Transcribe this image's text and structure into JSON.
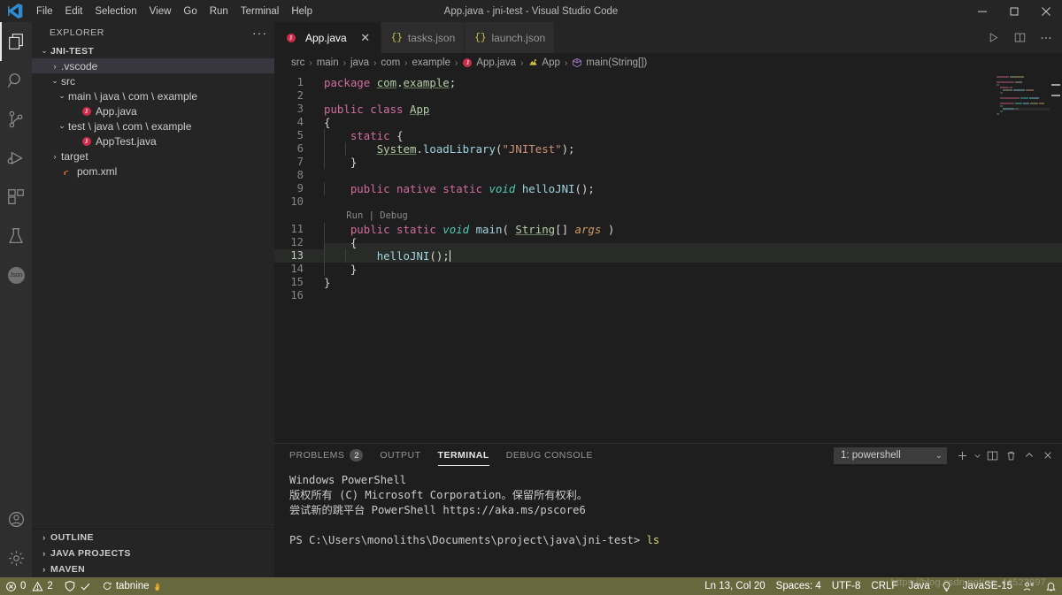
{
  "window": {
    "title": "App.java - jni-test - Visual Studio Code",
    "minimize_label": "─",
    "maximize_label": "❐",
    "close_label": "✕"
  },
  "menubar": {
    "items": [
      {
        "label": "File"
      },
      {
        "label": "Edit"
      },
      {
        "label": "Selection"
      },
      {
        "label": "View"
      },
      {
        "label": "Go"
      },
      {
        "label": "Run"
      },
      {
        "label": "Terminal"
      },
      {
        "label": "Help"
      }
    ]
  },
  "activitybar": {
    "items": [
      {
        "name": "explorer",
        "icon": "files-icon",
        "active": true
      },
      {
        "name": "search",
        "icon": "search-icon",
        "active": false
      },
      {
        "name": "source-control",
        "icon": "source-control-icon",
        "active": false
      },
      {
        "name": "run-and-debug",
        "icon": "run-debug-icon",
        "active": false
      },
      {
        "name": "extensions",
        "icon": "extensions-icon",
        "active": false
      },
      {
        "name": "testing",
        "icon": "beaker-icon",
        "active": false
      },
      {
        "name": "json-viewer",
        "icon": "json-badge-icon",
        "label": "Json",
        "active": false
      }
    ],
    "bottom": [
      {
        "name": "accounts",
        "icon": "account-icon"
      },
      {
        "name": "manage-settings",
        "icon": "gear-icon"
      }
    ]
  },
  "sidebar": {
    "header_title": "EXPLORER",
    "more_actions": "···",
    "tree": [
      {
        "label": "JNI-TEST",
        "kind": "root",
        "depth": 0,
        "twisty": "⌄",
        "selected": false
      },
      {
        "label": ".vscode",
        "kind": "folder",
        "depth": 1,
        "twisty": "›",
        "selected": true
      },
      {
        "label": "src",
        "kind": "folder",
        "depth": 1,
        "twisty": "⌄",
        "selected": false
      },
      {
        "label": "main \\ java \\ com \\ example",
        "kind": "folder",
        "depth": 2,
        "twisty": "⌄",
        "selected": false
      },
      {
        "label": "App.java",
        "kind": "java",
        "depth": 3,
        "twisty": "",
        "selected": false
      },
      {
        "label": "test \\ java \\ com \\ example",
        "kind": "folder",
        "depth": 2,
        "twisty": "⌄",
        "selected": false
      },
      {
        "label": "AppTest.java",
        "kind": "java",
        "depth": 3,
        "twisty": "",
        "selected": false
      },
      {
        "label": "target",
        "kind": "folder",
        "depth": 1,
        "twisty": "›",
        "selected": false
      },
      {
        "label": "pom.xml",
        "kind": "xml",
        "depth": 1,
        "twisty": "",
        "selected": false
      }
    ],
    "sections": [
      {
        "label": "OUTLINE",
        "twisty": "›"
      },
      {
        "label": "JAVA PROJECTS",
        "twisty": "›"
      },
      {
        "label": "MAVEN",
        "twisty": "›"
      }
    ]
  },
  "editor": {
    "tabs": [
      {
        "label": "App.java",
        "icon": "java-file-icon",
        "active": true,
        "closable": true,
        "close_label": "✕"
      },
      {
        "label": "tasks.json",
        "icon": "json-file-icon",
        "active": false,
        "closable": false
      },
      {
        "label": "launch.json",
        "icon": "json-file-icon",
        "active": false,
        "closable": false
      }
    ],
    "actions": [
      {
        "name": "run-code-button",
        "icon": "play-icon"
      },
      {
        "name": "split-editor-button",
        "icon": "split-editor-icon"
      },
      {
        "name": "more-actions-button",
        "icon": "ellipsis-icon"
      }
    ],
    "breadcrumbs": [
      {
        "label": "src",
        "icon": ""
      },
      {
        "label": "main",
        "icon": ""
      },
      {
        "label": "java",
        "icon": ""
      },
      {
        "label": "com",
        "icon": ""
      },
      {
        "label": "example",
        "icon": ""
      },
      {
        "label": "App.java",
        "icon": "java-file-icon"
      },
      {
        "label": "App",
        "icon": "class-icon"
      },
      {
        "label": "main(String[])",
        "icon": "method-icon"
      }
    ],
    "breadcrumb_separator": "›",
    "codelens": {
      "run": "Run",
      "divider": "|",
      "debug": "Debug"
    },
    "lines": [
      {
        "n": "1",
        "tokens": [
          {
            "t": "package ",
            "c": "k"
          },
          {
            "t": "com",
            "c": "typ"
          },
          {
            "t": ".",
            "c": "pun"
          },
          {
            "t": "example",
            "c": "typ"
          },
          {
            "t": ";",
            "c": "pun"
          }
        ]
      },
      {
        "n": "2",
        "tokens": []
      },
      {
        "n": "3",
        "tokens": [
          {
            "t": "public class ",
            "c": "k"
          },
          {
            "t": "App",
            "c": "cls"
          }
        ]
      },
      {
        "n": "4",
        "tokens": [
          {
            "t": "{",
            "c": "plain"
          }
        ]
      },
      {
        "n": "5",
        "tokens": [
          {
            "t": "    ",
            "c": "plain"
          },
          {
            "t": "static",
            "c": "k"
          },
          {
            "t": " {",
            "c": "plain"
          }
        ]
      },
      {
        "n": "6",
        "tokens": [
          {
            "t": "        ",
            "c": "plain"
          },
          {
            "t": "System",
            "c": "typ"
          },
          {
            "t": ".",
            "c": "pun"
          },
          {
            "t": "loadLibrary",
            "c": "fn"
          },
          {
            "t": "(",
            "c": "pun"
          },
          {
            "t": "\"JNITest\"",
            "c": "str"
          },
          {
            "t": ");",
            "c": "pun"
          }
        ]
      },
      {
        "n": "7",
        "tokens": [
          {
            "t": "    }",
            "c": "plain"
          }
        ]
      },
      {
        "n": "8",
        "tokens": []
      },
      {
        "n": "9",
        "tokens": [
          {
            "t": "    ",
            "c": "plain"
          },
          {
            "t": "public native static ",
            "c": "k"
          },
          {
            "t": "void",
            "c": "vd"
          },
          {
            "t": " ",
            "c": "plain"
          },
          {
            "t": "helloJNI",
            "c": "fn"
          },
          {
            "t": "();",
            "c": "pun"
          }
        ]
      },
      {
        "n": "10",
        "tokens": []
      },
      {
        "n": "11",
        "tokens": [
          {
            "t": "    ",
            "c": "plain"
          },
          {
            "t": "public static ",
            "c": "k"
          },
          {
            "t": "void",
            "c": "vd"
          },
          {
            "t": " ",
            "c": "plain"
          },
          {
            "t": "main",
            "c": "fn"
          },
          {
            "t": "( ",
            "c": "pun"
          },
          {
            "t": "String",
            "c": "cls"
          },
          {
            "t": "[] ",
            "c": "pun"
          },
          {
            "t": "args",
            "c": "prm"
          },
          {
            "t": " )",
            "c": "pun"
          }
        ]
      },
      {
        "n": "12",
        "tokens": [
          {
            "t": "    {",
            "c": "plain"
          }
        ]
      },
      {
        "n": "13",
        "tokens": [
          {
            "t": "        ",
            "c": "plain"
          },
          {
            "t": "helloJNI",
            "c": "fn"
          },
          {
            "t": "();",
            "c": "pun"
          }
        ],
        "highlight": true,
        "caret": true
      },
      {
        "n": "14",
        "tokens": [
          {
            "t": "    }",
            "c": "plain"
          }
        ]
      },
      {
        "n": "15",
        "tokens": [
          {
            "t": "}",
            "c": "plain"
          }
        ]
      },
      {
        "n": "16",
        "tokens": []
      }
    ]
  },
  "panel": {
    "tabs": [
      {
        "label": "PROBLEMS",
        "badge": "2",
        "active": false
      },
      {
        "label": "OUTPUT",
        "badge": "",
        "active": false
      },
      {
        "label": "TERMINAL",
        "badge": "",
        "active": true
      },
      {
        "label": "DEBUG CONSOLE",
        "badge": "",
        "active": false
      }
    ],
    "terminal_selector": {
      "value": "1: powershell",
      "chevron": "⌄"
    },
    "actions": [
      {
        "name": "new-terminal-button",
        "icon": "plus-icon"
      },
      {
        "name": "new-terminal-dropdown",
        "icon": "chevron-down-icon"
      },
      {
        "name": "split-terminal-button",
        "icon": "split-icon"
      },
      {
        "name": "kill-terminal-button",
        "icon": "trash-icon"
      },
      {
        "name": "maximize-panel-button",
        "icon": "chevron-up-icon"
      },
      {
        "name": "close-panel-button",
        "icon": "close-icon"
      }
    ],
    "terminal_lines": [
      {
        "text": "Windows PowerShell",
        "cmd": ""
      },
      {
        "text": "版权所有 (C) Microsoft Corporation。保留所有权利。",
        "cmd": ""
      },
      {
        "text": "",
        "cmd": ""
      },
      {
        "text": "尝试新的跳平台 PowerShell https://aka.ms/pscore6",
        "cmd": ""
      },
      {
        "text": "",
        "cmd": ""
      },
      {
        "text": "PS C:\\Users\\monoliths\\Documents\\project\\java\\jni-test> ",
        "cmd": "ls"
      }
    ]
  },
  "statusbar": {
    "left": [
      {
        "name": "problems-status",
        "icon": "error-icon",
        "text": "0",
        "icon2": "warning-icon",
        "text2": "2"
      },
      {
        "name": "remote-status",
        "icon": "shield-check-icon",
        "text": ""
      },
      {
        "name": "tabnine-status",
        "icon": "tabnine-icon",
        "text": "tabnine"
      }
    ],
    "right": [
      {
        "name": "editor-position",
        "text": "Ln 13, Col 20"
      },
      {
        "name": "editor-indentation",
        "text": "Spaces: 4"
      },
      {
        "name": "editor-encoding",
        "text": "UTF-8"
      },
      {
        "name": "editor-eol",
        "text": "CRLF"
      },
      {
        "name": "editor-language",
        "text": "Java"
      },
      {
        "name": "java-lightbulb",
        "text": ""
      },
      {
        "name": "java-runtime",
        "text": "JavaSE-15"
      },
      {
        "name": "feedback",
        "text": ""
      },
      {
        "name": "notifications",
        "text": ""
      }
    ],
    "background_color": "#68683f"
  },
  "watermark": {
    "text": "https://blog.csdn.net/qq_44523997"
  }
}
